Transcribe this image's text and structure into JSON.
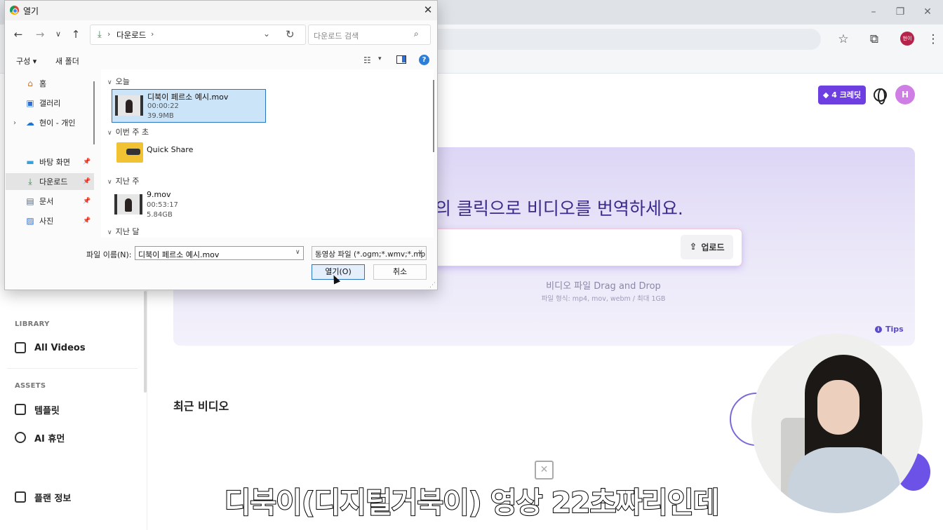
{
  "browser": {
    "profile_initials": "현이",
    "icons": [
      "star-icon",
      "extensions-icon",
      "kebab-menu-icon"
    ]
  },
  "app": {
    "credits_label": "4 크레딧",
    "user_initial": "H",
    "sidebar": {
      "library_header": "LIBRARY",
      "all_videos": "All Videos",
      "assets_header": "ASSETS",
      "templates": "템플릿",
      "ai_human": "AI 휴먼",
      "plan_info": "플랜 정보"
    },
    "hero": {
      "title_visible": "의 클릭으로 비디오를 번역하세요.",
      "upload_label": "업로드",
      "drag_drop_text": "비디오 파일 Drag and Drop",
      "format_text": "파일 형식: mp4, mov, webm / 최대 1GB",
      "tips_label": "Tips"
    },
    "recent_videos_title": "최근 비디오",
    "accent_color": "#6d3fe0"
  },
  "dialog": {
    "title": "열기",
    "path": "다운로드",
    "search_placeholder": "다운로드 검색",
    "organize_label": "구성",
    "new_folder_label": "새 폴더",
    "nav_items": [
      {
        "label": "홈",
        "icon": "home-icon"
      },
      {
        "label": "갤러리",
        "icon": "gallery-icon"
      },
      {
        "label": "현이 - 개인",
        "icon": "cloud-icon"
      },
      {
        "label": "바탕 화면",
        "icon": "desktop-icon"
      },
      {
        "label": "다운로드",
        "icon": "download-icon"
      },
      {
        "label": "문서",
        "icon": "document-icon"
      },
      {
        "label": "사진",
        "icon": "pictures-icon"
      }
    ],
    "groups": [
      {
        "label": "오늘"
      },
      {
        "label": "이번 주 초"
      },
      {
        "label": "지난 주"
      },
      {
        "label": "지난 달"
      }
    ],
    "files": [
      {
        "name": "디북이 페르소 예시.mov",
        "duration": "00:00:22",
        "size": "39.9MB"
      },
      {
        "name": "Quick Share"
      },
      {
        "name": "9.mov",
        "duration": "00:53:17",
        "size": "5.84GB"
      }
    ],
    "filename_label": "파일 이름(N):",
    "filename_value": "디북이 페르소 예시.mov",
    "filetype_value": "동영상 파일 (*.ogm;*.wmv;*.mp",
    "open_button": "열기(O)",
    "cancel_button": "취소"
  },
  "subtitle": "디북이(디지털거북이) 영상 22초짜리인데"
}
